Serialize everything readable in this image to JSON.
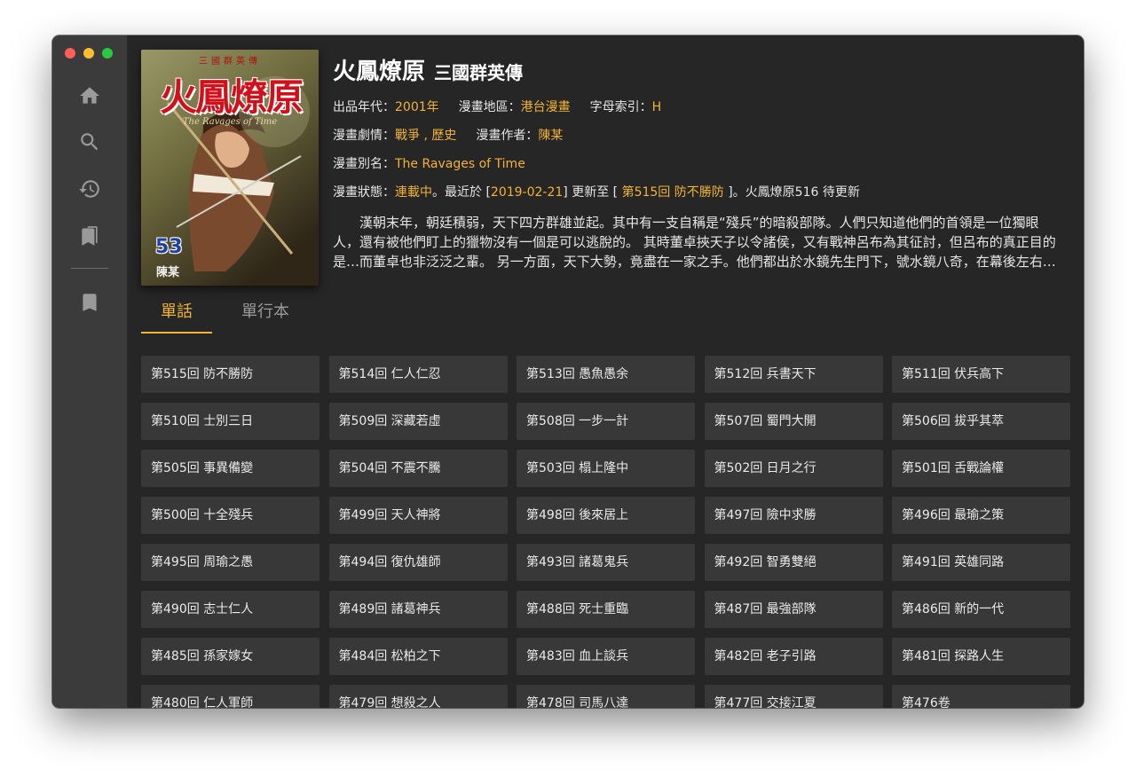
{
  "window": {
    "controls": [
      "close",
      "minimize",
      "maximize"
    ]
  },
  "sidebar": {
    "items": [
      {
        "icon": "home-icon"
      },
      {
        "icon": "search-icon"
      },
      {
        "icon": "history-icon"
      },
      {
        "icon": "library-icon"
      },
      {
        "icon": "bookmark-icon"
      }
    ]
  },
  "cover": {
    "top_text": "三國群英傳",
    "title": "火鳳燎原",
    "en_title": "The Ravages of Time",
    "volume": "53",
    "author": "陳某"
  },
  "manga": {
    "title": "火鳳燎原",
    "subtitle": "三國群英傳",
    "year_label": "出品年代：",
    "year": "2001年",
    "region_label": "漫畫地區：",
    "region": "港台漫畫",
    "index_label": "字母索引：",
    "index": "H",
    "genre_label": "漫畫劇情：",
    "genre": "戰爭 , 歷史",
    "author_label": "漫畫作者：",
    "author": "陳某",
    "alias_label": "漫畫別名：",
    "alias": "The Ravages of Time",
    "status_label": "漫畫狀態：",
    "status": "連載中",
    "status_text1": "。最近於 [",
    "update_date": "2019-02-21",
    "status_text2": "] 更新至 [ ",
    "latest_chapter": "第515回 防不勝防",
    "status_text3": " ]。火鳳燎原516 待更新",
    "description": "漢朝末年，朝廷積弱，天下四方群雄並起。其中有一支自稱是“殘兵”的暗殺部隊。人們只知道他們的首領是一位獨眼人，還有被他們盯上的獵物沒有一個是可以逃脫的。 其時董卓挾天子以令諸侯，又有戰神呂布為其征討，但呂布的真正目的是…而董卓也非泛泛之輩。 另一方面，天下大勢，竟盡在一家之手。他們都出於水鏡先生門下，號水鏡八奇，在幕後左右天下大勢……"
  },
  "tabs": [
    {
      "label": "單話"
    },
    {
      "label": "單行本"
    }
  ],
  "chapters": [
    "第515回 防不勝防",
    "第514回 仁人仁忍",
    "第513回 愚魚愚余",
    "第512回 兵書天下",
    "第511回 伏兵高下",
    "第510回 士別三日",
    "第509回 深藏若虛",
    "第508回 一步一計",
    "第507回 蜀門大開",
    "第506回 拔乎其萃",
    "第505回 事異備變",
    "第504回 不震不騰",
    "第503回 榻上隆中",
    "第502回 日月之行",
    "第501回 舌戰論權",
    "第500回 十全殘兵",
    "第499回 天人神將",
    "第498回 後來居上",
    "第497回 險中求勝",
    "第496回 最瑜之策",
    "第495回 周瑜之愚",
    "第494回 復仇雄師",
    "第493回 諸葛鬼兵",
    "第492回 智勇雙絕",
    "第491回 英雄同路",
    "第490回 志士仁人",
    "第489回 諸葛神兵",
    "第488回 死士重臨",
    "第487回 最強部隊",
    "第486回 新的一代",
    "第485回 孫家嫁女",
    "第484回 松柏之下",
    "第483回 血上談兵",
    "第482回 老子引路",
    "第481回 探路人生",
    "第480回 仁人軍師",
    "第479回 想殺之人",
    "第478回 司馬八達",
    "第477回 交接江夏",
    "第476卷"
  ],
  "colors": {
    "accent": "#f2b336",
    "background": "#262626",
    "sidebar": "#3b3b3b",
    "chapter_bg": "#383838"
  }
}
